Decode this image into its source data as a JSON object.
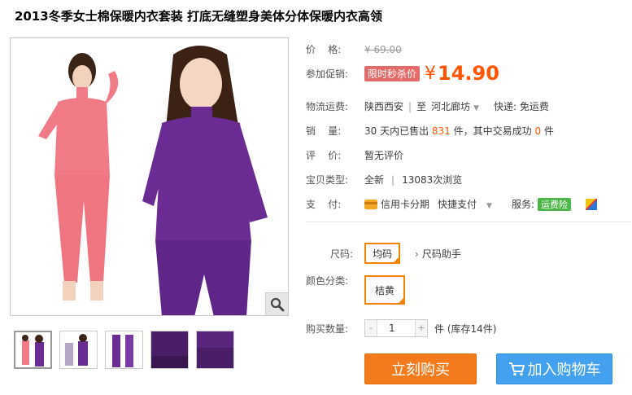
{
  "product": {
    "title": "2013冬季女士棉保暖内衣套装 打底无缝塑身美体分体保暖内衣高领"
  },
  "price": {
    "label": "价    格:",
    "original": "¥ 69.00",
    "promo_label": "参加促销:",
    "promo_badge": "限时秒杀价",
    "yen": "¥",
    "current": "14.90"
  },
  "shipping": {
    "label": "物流运费:",
    "from": "陕西西安",
    "sep": "|",
    "to_prefix": "至",
    "to": "河北廊坊",
    "express": "快递: 免运费"
  },
  "sales": {
    "label": "销    量:",
    "prefix": "30 天内已售出 ",
    "count": "831",
    "mid": " 件，其中交易成功 ",
    "success": "0",
    "suffix": " 件"
  },
  "rating": {
    "label": "评    价:",
    "value": "暂无评价"
  },
  "type": {
    "label": "宝贝类型:",
    "value": "全新",
    "sep": "|",
    "views": "13083次浏览"
  },
  "payment": {
    "label": "支    付:",
    "credit": "信用卡分期",
    "quick": "快捷支付",
    "service_label": "服务:",
    "service_badge": "运费险"
  },
  "size": {
    "label": "尺码:",
    "option": "均码",
    "helper": "尺码助手"
  },
  "color": {
    "label": "颜色分类:",
    "option": "桔黄"
  },
  "quantity": {
    "label": "购买数量:",
    "minus": "-",
    "value": "1",
    "plus": "+",
    "stock": "件 (库存14件)"
  },
  "actions": {
    "buy": "立刻购买",
    "cart": "加入购物车"
  },
  "colors": {
    "accent": "#ff5500",
    "buy": "#f37b1d",
    "cart": "#43a1f0",
    "pink_outfit": "#f07b86",
    "purple_outfit": "#6a2c93"
  }
}
